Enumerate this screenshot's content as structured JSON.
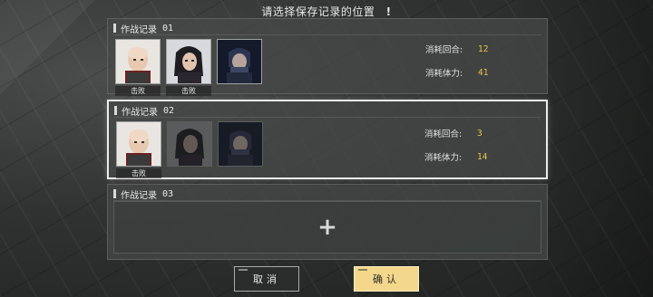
{
  "prompt": {
    "text": "请选择保存记录的位置",
    "icon": "exclamation-icon",
    "icon_glyph": "!"
  },
  "slots": [
    {
      "label": "作战记录",
      "number": "01",
      "selected": false,
      "characters": [
        {
          "portrait": "bald-man-portrait",
          "status": "击败"
        },
        {
          "portrait": "dark-haired-woman-portrait",
          "status": "击败"
        },
        {
          "portrait": "armored-masked-portrait",
          "status": ""
        }
      ],
      "stats": [
        {
          "label": "消耗回合:",
          "value": "12"
        },
        {
          "label": "消耗体力:",
          "value": "41"
        }
      ]
    },
    {
      "label": "作战记录",
      "number": "02",
      "selected": true,
      "characters": [
        {
          "portrait": "bald-man-portrait",
          "status": "击败"
        },
        {
          "portrait": "dark-haired-woman-portrait",
          "status": ""
        },
        {
          "portrait": "armored-masked-portrait",
          "status": ""
        }
      ],
      "stats": [
        {
          "label": "消耗回合:",
          "value": "3"
        },
        {
          "label": "消耗体力:",
          "value": "14"
        }
      ]
    },
    {
      "label": "作战记录",
      "number": "03",
      "empty": true,
      "add_icon": "plus-icon",
      "add_glyph": "+"
    }
  ],
  "buttons": {
    "cancel": "取消",
    "confirm": "确认"
  },
  "colors": {
    "accent": "#e8c24a",
    "confirm_bg": "#f3d78a"
  }
}
